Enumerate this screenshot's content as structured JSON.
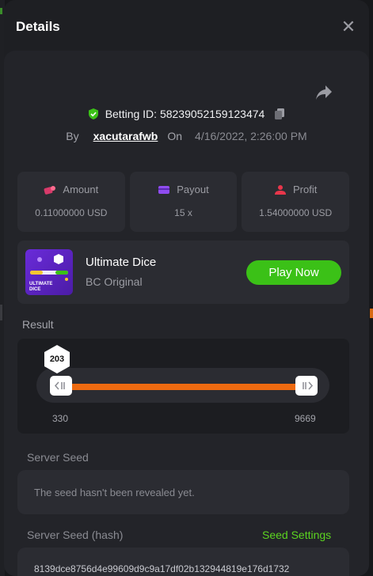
{
  "modal": {
    "title": "Details"
  },
  "bet": {
    "id_label": "Betting ID: 58239052159123474",
    "by_label": "By",
    "username": "xacutarafwb",
    "on_label": "On",
    "date": "4/16/2022, 2:26:00 PM"
  },
  "stats": [
    {
      "label": "Amount",
      "value": "0.11000000 USD",
      "icon": "amount-icon"
    },
    {
      "label": "Payout",
      "value": "15 x",
      "icon": "payout-icon"
    },
    {
      "label": "Profit",
      "value": "1.54000000 USD",
      "icon": "profit-icon"
    }
  ],
  "game": {
    "name": "Ultimate Dice",
    "provider": "BC Original",
    "play_label": "Play Now",
    "thumb_text_top": "ULTIMATE",
    "thumb_text_bottom": "DICE"
  },
  "result": {
    "label": "Result",
    "value": "203",
    "range_min": "330",
    "range_max": "9669"
  },
  "server_seed": {
    "label": "Server Seed",
    "text": "The seed hasn't been revealed yet."
  },
  "server_seed_hash": {
    "label": "Server Seed (hash)",
    "settings_label": "Seed Settings",
    "hash": "8139dce8756d4e99609d9c9a17df02b132944819e176d1732"
  },
  "colors": {
    "accent_green": "#3bc117",
    "accent_orange": "#ee6a10",
    "panel": "#2b2c32",
    "background": "#1e1f23"
  }
}
